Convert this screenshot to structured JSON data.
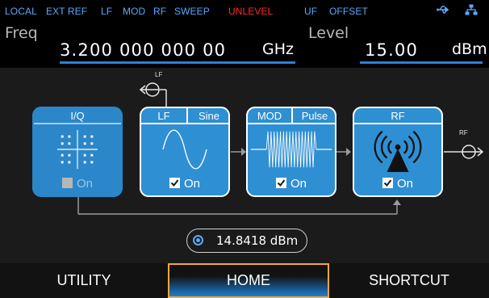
{
  "status": {
    "local": "LOCAL",
    "ext_ref": "EXT REF",
    "lf": "LF",
    "mod": "MOD",
    "rf": "RF",
    "sweep": "SWEEP",
    "unlevel": "UNLEVEL",
    "uf": "UF",
    "offset": "OFFSET",
    "usb_icon": "usb-icon",
    "lan_icon": "lan-icon",
    "colors": {
      "normal": "#5aa9ff",
      "alert": "#ff2a2a"
    }
  },
  "freq": {
    "label": "Freq",
    "value": "3.200 000 000 00",
    "unit": "GHz"
  },
  "level": {
    "label": "Level",
    "value": "15.00",
    "unit": "dBm"
  },
  "blocks": {
    "iq": {
      "title": "I/Q",
      "on_label": "On",
      "enabled": false,
      "icon": "constellation-icon"
    },
    "lf": {
      "title": "LF",
      "waveform": "Sine",
      "on_label": "On",
      "enabled": true,
      "icon": "sine-wave-icon",
      "output_label": "LF"
    },
    "mod": {
      "title": "MOD",
      "type": "Pulse",
      "on_label": "On",
      "enabled": true,
      "icon": "pulse-icon"
    },
    "rf": {
      "title": "RF",
      "on_label": "On",
      "enabled": true,
      "icon": "antenna-icon",
      "output_label": "RF"
    }
  },
  "reading": {
    "value": "14.8418 dBm",
    "icon": "radio-selected-icon"
  },
  "softkeys": {
    "utility": "UTILITY",
    "home": "HOME",
    "shortcut": "SHORTCUT",
    "active": "HOME"
  },
  "colors": {
    "accent": "#2a7fd8",
    "block": "#2f8fd3",
    "softkey_active_border": "#f3a73a"
  }
}
